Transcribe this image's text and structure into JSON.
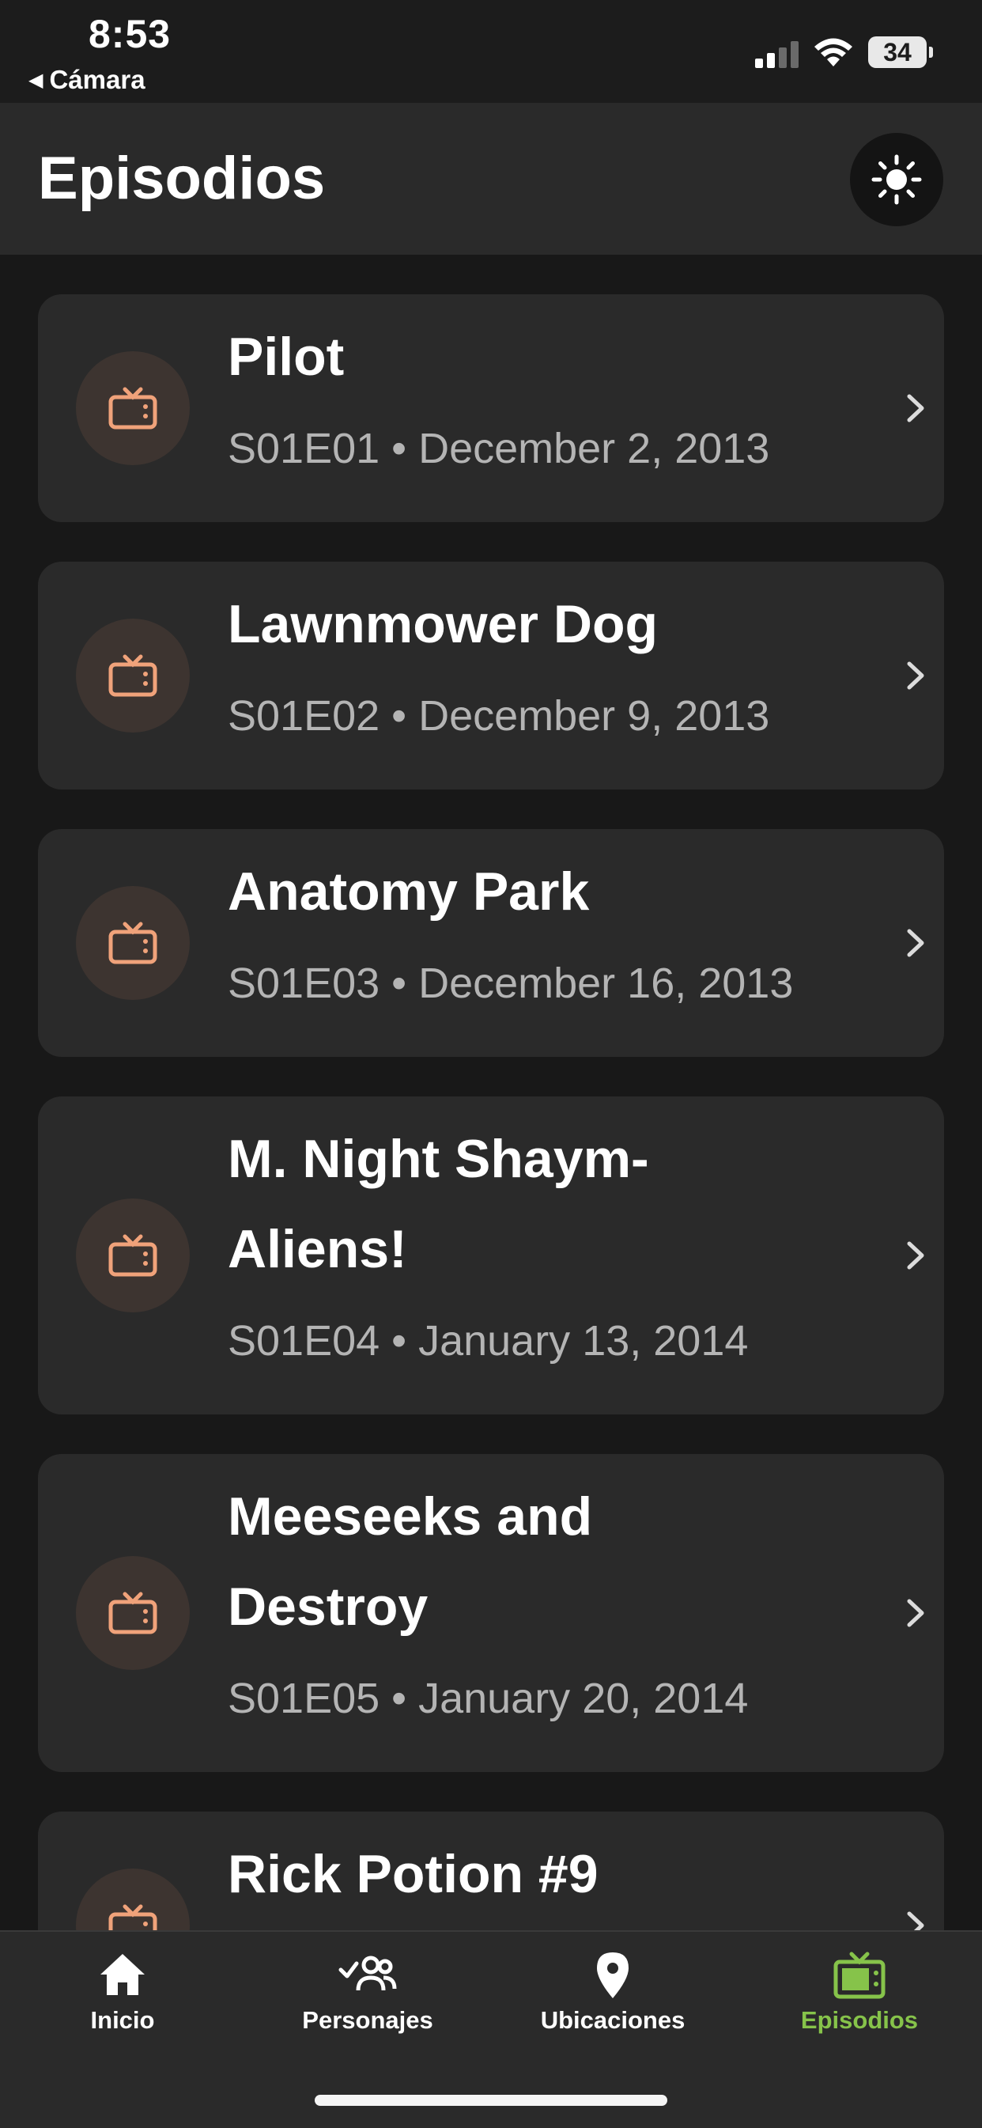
{
  "status_bar": {
    "time": "8:53",
    "back_label": "Cámara",
    "battery": "34"
  },
  "header": {
    "title": "Episodios",
    "theme_toggle_icon": "sun-icon"
  },
  "episodes": [
    {
      "title": "Pilot",
      "code": "S01E01",
      "date": "December 2, 2013",
      "meta": "S01E01 • December 2, 2013"
    },
    {
      "title": "Lawnmower Dog",
      "code": "S01E02",
      "date": "December 9, 2013",
      "meta": "S01E02 • December 9, 2013"
    },
    {
      "title": "Anatomy Park",
      "code": "S01E03",
      "date": "December 16, 2013",
      "meta": "S01E03 • December 16, 2013"
    },
    {
      "title": "M. Night Shaym-Aliens!",
      "code": "S01E04",
      "date": "January 13, 2014",
      "meta": "S01E04 • January 13, 2014"
    },
    {
      "title": "Meeseeks and Destroy",
      "code": "S01E05",
      "date": "January 20, 2014",
      "meta": "S01E05 • January 20, 2014"
    },
    {
      "title": "Rick Potion #9",
      "code": "",
      "date": "",
      "meta": ""
    }
  ],
  "tabbar": {
    "tabs": [
      {
        "label": "Inicio",
        "icon": "home-icon"
      },
      {
        "label": "Personajes",
        "icon": "people-icon"
      },
      {
        "label": "Ubicaciones",
        "icon": "location-pin-icon"
      },
      {
        "label": "Episodios",
        "icon": "tv-icon"
      }
    ],
    "active_index": 3
  },
  "colors": {
    "background": "#181818",
    "card": "#2a2a2a",
    "episode_icon": "#f0a27a",
    "active_tab": "#86c34a",
    "meta_text": "#b4b4b4"
  }
}
